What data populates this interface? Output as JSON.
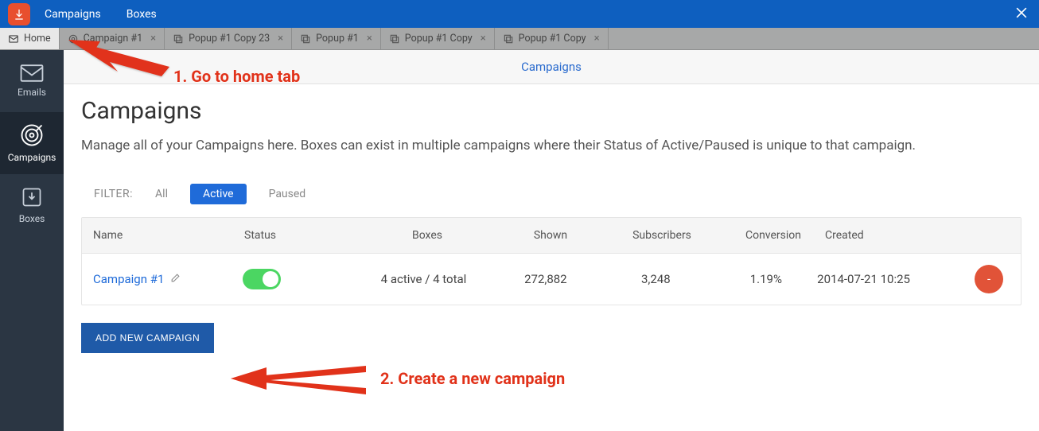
{
  "topbar": {
    "links": [
      "Campaigns",
      "Boxes"
    ]
  },
  "tabs": [
    {
      "label": "Home",
      "icon": "envelope",
      "active": true
    },
    {
      "label": "Campaign #1",
      "icon": "target",
      "closeable": true
    },
    {
      "label": "Popup #1 Copy 23",
      "icon": "popup",
      "closeable": true
    },
    {
      "label": "Popup #1",
      "icon": "popup",
      "closeable": true
    },
    {
      "label": "Popup #1 Copy",
      "icon": "popup",
      "closeable": true
    },
    {
      "label": "Popup #1 Copy",
      "icon": "popup",
      "closeable": true
    }
  ],
  "sidebar": {
    "items": [
      {
        "label": "Emails",
        "icon": "envelope"
      },
      {
        "label": "Campaigns",
        "icon": "target",
        "active": true
      },
      {
        "label": "Boxes",
        "icon": "box"
      }
    ]
  },
  "subheader": {
    "title": "Campaigns"
  },
  "page": {
    "title": "Campaigns",
    "description": "Manage all of your Campaigns here. Boxes can exist in multiple campaigns where their Status of Active/Paused is unique to that campaign."
  },
  "filter": {
    "label": "FILTER:",
    "options": [
      "All",
      "Active",
      "Paused"
    ],
    "active_index": 1
  },
  "table": {
    "headers": [
      "Name",
      "Status",
      "Boxes",
      "Shown",
      "Subscribers",
      "Conversion",
      "Created"
    ],
    "rows": [
      {
        "name": "Campaign #1",
        "status_on": true,
        "boxes": "4 active / 4 total",
        "shown": "272,882",
        "subscribers": "3,248",
        "conversion": "1.19%",
        "created": "2014-07-21 10:25",
        "action_label": "-"
      }
    ]
  },
  "buttons": {
    "add_campaign": "ADD NEW CAMPAIGN"
  },
  "annotations": {
    "step1": "1. Go to home tab",
    "step2": "2. Create a new campaign"
  }
}
